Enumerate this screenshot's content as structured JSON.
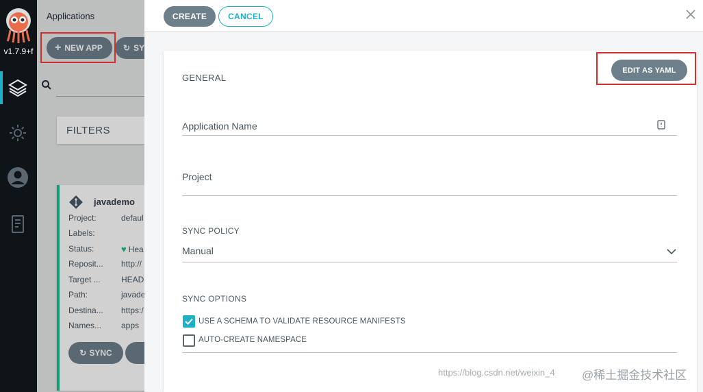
{
  "nav": {
    "version": "v1.7.9+f",
    "items": [
      {
        "icon": "layers-icon"
      },
      {
        "icon": "gear-icon"
      },
      {
        "icon": "user-icon"
      },
      {
        "icon": "docs-icon"
      }
    ]
  },
  "background": {
    "title": "Applications",
    "new_app_label": "NEW APP",
    "sync_label": "SY",
    "filters_label": "FILTERS",
    "card": {
      "title": "javademo",
      "rows": [
        {
          "label": "Project:",
          "value": "defaul"
        },
        {
          "label": "Labels:",
          "value": ""
        },
        {
          "label": "Status:",
          "value": "Hea"
        },
        {
          "label": "Reposit...",
          "value": "http://"
        },
        {
          "label": "Target ...",
          "value": "HEAD"
        },
        {
          "label": "Path:",
          "value": "javade"
        },
        {
          "label": "Destina...",
          "value": "https:/"
        },
        {
          "label": "Names...",
          "value": "apps"
        }
      ],
      "sync_label": "SYNC"
    }
  },
  "panel": {
    "create_label": "CREATE",
    "cancel_label": "CANCEL",
    "edit_yaml_label": "EDIT AS YAML",
    "general_title": "GENERAL",
    "app_name_label": "Application Name",
    "project_label": "Project",
    "sync_policy_title": "SYNC POLICY",
    "sync_policy_value": "Manual",
    "sync_options_title": "SYNC OPTIONS",
    "options": [
      {
        "label": "USE A SCHEMA TO VALIDATE RESOURCE MANIFESTS",
        "checked": true
      },
      {
        "label": "AUTO-CREATE NAMESPACE",
        "checked": false
      }
    ]
  },
  "watermark": {
    "url": "https://blog.csdn.net/weixin_4",
    "logo_text": "@稀土掘金技术社区"
  },
  "colors": {
    "accent": "#1fb0c8",
    "button_gray": "#6d7f8b",
    "healthy": "#18be94",
    "highlight_red": "#d32f2f"
  }
}
